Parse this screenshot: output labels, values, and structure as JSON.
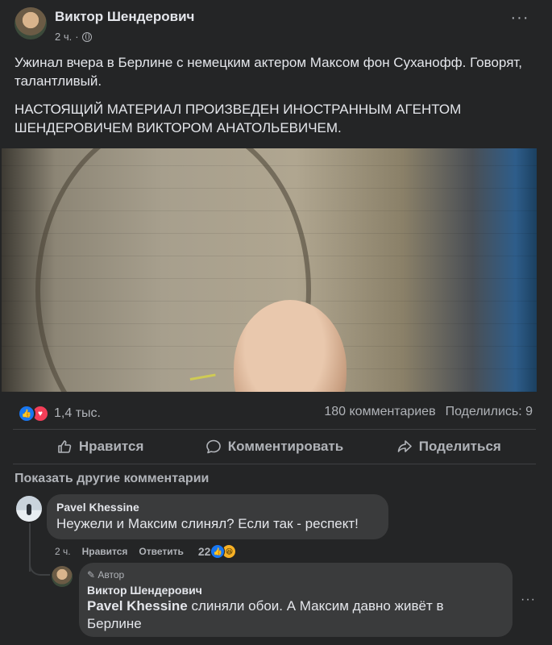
{
  "post": {
    "author": "Виктор Шендерович",
    "time": "2 ч.",
    "text_p1": "Ужинал вчера в Берлине с немецким актером Максом фон Суханофф. Говорят, талантливый.",
    "text_p2": "НАСТОЯЩИЙ МАТЕРИАЛ ПРОИЗВЕДЕН ИНОСТРАННЫМ АГЕНТОМ ШЕНДЕРОВИЧЕМ ВИКТОРОМ АНАТОЛЬЕВИЧЕМ.",
    "more_icon": "ellipsis-icon",
    "privacy_icon": "globe-icon"
  },
  "stats": {
    "reactions_count": "1,4 тыс.",
    "comments": "180 комментариев",
    "shares": "Поделились: 9"
  },
  "actions": {
    "like": "Нравится",
    "comment": "Комментировать",
    "share": "Поделиться"
  },
  "comments": {
    "show_more": "Показать другие комментарии",
    "items": [
      {
        "name": "Pavel Khessine",
        "text": "Неужели и Максим слинял? Если так - респект!",
        "time": "2 ч.",
        "like_label": "Нравится",
        "reply_label": "Ответить",
        "reactions_count": "22"
      }
    ],
    "reply": {
      "badge": "Автор",
      "name": "Виктор Шендерович",
      "mention": "Pavel Khessine",
      "text": " слиняли обои. А Максим давно живёт в Берлине"
    }
  },
  "colors": {
    "background": "#242526",
    "bubble": "#3a3b3c",
    "like_blue": "#1877f2",
    "love_red": "#f33e58",
    "text_primary": "#e4e6eb",
    "text_secondary": "#b0b3b8"
  }
}
